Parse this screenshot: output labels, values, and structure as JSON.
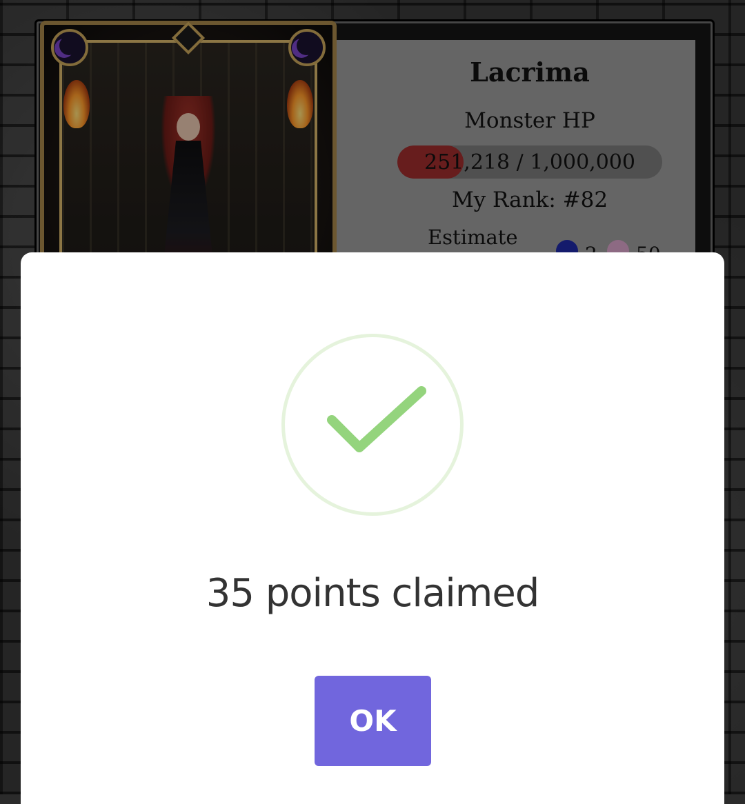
{
  "boss": {
    "name": "Lacrima",
    "hp_label": "Monster HP",
    "hp_text": "251,218 / 1,000,000",
    "hp_fraction": 0.251218,
    "rank_text": "My Rank: #82",
    "estimate_label": "Estimate",
    "rewards": [
      {
        "icon": "blue-token-icon",
        "value": "2",
        "color": "#1f2aa6"
      },
      {
        "icon": "pink-avatar-icon",
        "value": "50",
        "color": "#d9a3c9"
      }
    ]
  },
  "dialog": {
    "icon": "check-icon",
    "title": "35 points claimed",
    "ok_label": "OK",
    "accent": "#7166dd",
    "check_color": "#94d47d"
  }
}
